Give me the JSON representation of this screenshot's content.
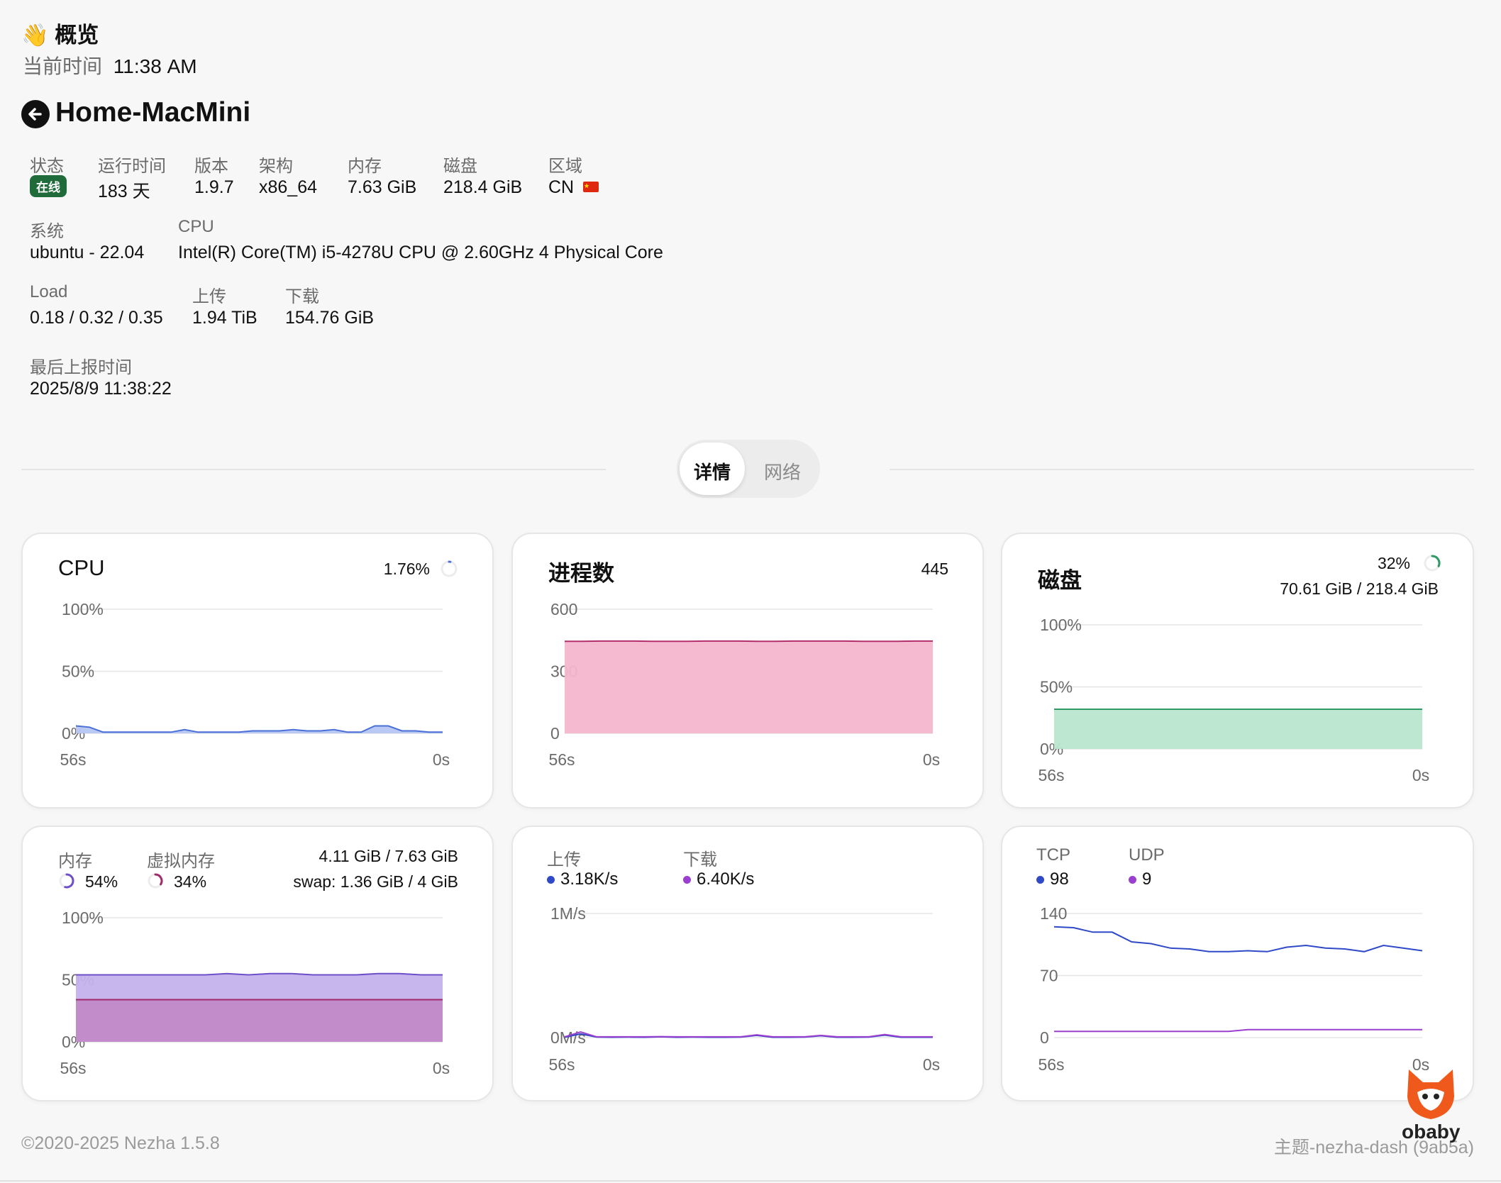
{
  "header": {
    "wave_icon": "waving-hand-icon",
    "title": "概览",
    "time_label": "当前时间",
    "time_value": "11:38 AM"
  },
  "server": {
    "name": "Home-MacMini",
    "back_icon": "arrow-left-circle-icon",
    "fields_row1": [
      {
        "label": "状态",
        "value": "在线"
      },
      {
        "label": "运行时间",
        "value": "183 天"
      },
      {
        "label": "版本",
        "value": "1.9.7"
      },
      {
        "label": "架构",
        "value": "x86_64"
      },
      {
        "label": "内存",
        "value": "7.63 GiB"
      },
      {
        "label": "磁盘",
        "value": "218.4 GiB"
      },
      {
        "label": "区域",
        "value": "CN"
      }
    ],
    "fields_row2": [
      {
        "label": "系统",
        "value": "ubuntu - 22.04"
      },
      {
        "label": "CPU",
        "value": "Intel(R) Core(TM) i5-4278U CPU @ 2.60GHz 4 Physical Core"
      }
    ],
    "fields_row3": [
      {
        "label": "Load",
        "value": "0.18 / 0.32 / 0.35"
      },
      {
        "label": "上传",
        "value": "1.94 TiB"
      },
      {
        "label": "下载",
        "value": "154.76 GiB"
      }
    ],
    "fields_row4": [
      {
        "label": "最后上报时间",
        "value": "2025/8/9 11:38:22"
      }
    ],
    "flag_icon": "china-flag-icon"
  },
  "tabs": [
    {
      "label": "详情",
      "active": true
    },
    {
      "label": "网络",
      "active": false
    }
  ],
  "cards": {
    "cpu": {
      "title": "CPU",
      "value": "1.76%",
      "ring_fraction": 0.0176
    },
    "process": {
      "title": "进程数",
      "value": "445"
    },
    "disk": {
      "title": "磁盘",
      "percent": "32%",
      "detail": "70.61 GiB / 218.4 GiB",
      "ring_fraction": 0.32
    },
    "memory": {
      "mem_label": "内存",
      "mem_percent": "54%",
      "mem_fraction": 0.54,
      "swap_label": "虚拟内存",
      "swap_percent": "34%",
      "swap_fraction": 0.34,
      "mem_detail": "4.11 GiB / 7.63 GiB",
      "swap_detail": "swap: 1.36 GiB / 4 GiB"
    },
    "network": {
      "up_label": "上传",
      "up_value": "3.18K/s",
      "down_label": "下载",
      "down_value": "6.40K/s"
    },
    "connections": {
      "tcp_label": "TCP",
      "tcp_value": "98",
      "udp_label": "UDP",
      "udp_value": "9"
    }
  },
  "chart_data": [
    {
      "type": "area",
      "name": "cpu",
      "x_labels": [
        "56s",
        "0s"
      ],
      "y_ticks": [
        "100%",
        "50%",
        "0%"
      ],
      "ylim": [
        0,
        100
      ],
      "color": "#4a6fd6",
      "fill": "#b5c6f2",
      "values": [
        6,
        5,
        1,
        1,
        1,
        1,
        1,
        1,
        3,
        1,
        1,
        1,
        1,
        2,
        2,
        2,
        3,
        2,
        2,
        3,
        1,
        1,
        6,
        6,
        2,
        2,
        1,
        1
      ]
    },
    {
      "type": "area",
      "name": "process",
      "x_labels": [
        "56s",
        "0s"
      ],
      "y_ticks": [
        "600",
        "300",
        "0"
      ],
      "ylim": [
        0,
        600
      ],
      "color": "#b3306e",
      "fill": "#f5b6cd",
      "values": [
        445,
        445,
        446,
        446,
        446,
        445,
        445,
        445,
        446,
        446,
        446,
        445,
        445,
        446,
        446,
        446,
        446,
        445,
        445,
        445,
        446,
        446
      ]
    },
    {
      "type": "area",
      "name": "disk",
      "x_labels": [
        "56s",
        "0s"
      ],
      "y_ticks": [
        "100%",
        "50%",
        "0%"
      ],
      "ylim": [
        0,
        100
      ],
      "color": "#2f9a63",
      "fill": "#b9e6cf",
      "values": [
        32,
        32,
        32,
        32,
        32,
        32,
        32,
        32,
        32,
        32
      ]
    },
    {
      "type": "area",
      "name": "memory",
      "x_labels": [
        "56s",
        "0s"
      ],
      "y_ticks": [
        "100%",
        "50%",
        "0%"
      ],
      "ylim": [
        0,
        100
      ],
      "series": [
        {
          "name": "内存",
          "color": "#6e4fc9",
          "fill": "#c3b2ec",
          "values": [
            54,
            54,
            54,
            54,
            54,
            54,
            54,
            55,
            54,
            55,
            55,
            54,
            54,
            54,
            55,
            55,
            54,
            54
          ]
        },
        {
          "name": "虚拟内存",
          "color": "#a02a6a",
          "fill": "#c289c7",
          "values": [
            34,
            34,
            34,
            34,
            34,
            34,
            34,
            34,
            34,
            34,
            34,
            34,
            34,
            34,
            34,
            34,
            34,
            34
          ]
        }
      ]
    },
    {
      "type": "line",
      "name": "network",
      "x_labels": [
        "56s",
        "0s"
      ],
      "y_ticks": [
        "1M/s",
        "0M/s"
      ],
      "ylim": [
        0,
        1000
      ],
      "series": [
        {
          "name": "上传",
          "color": "#2f49c7",
          "values": [
            3,
            30,
            4,
            3,
            4,
            3,
            6,
            3,
            4,
            3,
            3,
            4,
            18,
            3,
            3,
            4,
            15,
            3,
            3,
            4,
            20,
            3,
            3,
            3
          ]
        },
        {
          "name": "下载",
          "color": "#9a3fd0",
          "values": [
            6,
            45,
            6,
            6,
            6,
            6,
            8,
            6,
            6,
            6,
            6,
            6,
            22,
            6,
            6,
            6,
            18,
            6,
            6,
            6,
            25,
            6,
            6,
            6
          ]
        }
      ]
    },
    {
      "type": "line",
      "name": "connections",
      "x_labels": [
        "56s",
        "0s"
      ],
      "y_ticks": [
        "140",
        "70",
        "0"
      ],
      "ylim": [
        0,
        140
      ],
      "series": [
        {
          "name": "TCP",
          "color": "#2f49c7",
          "values": [
            125,
            124,
            119,
            119,
            108,
            106,
            101,
            100,
            97,
            97,
            98,
            97,
            102,
            104,
            101,
            100,
            97,
            104,
            101,
            98
          ]
        },
        {
          "name": "UDP",
          "color": "#9a3fd0",
          "values": [
            7,
            7,
            7,
            7,
            7,
            7,
            7,
            7,
            7,
            7,
            9,
            9,
            9,
            9,
            9,
            9,
            9,
            9,
            9,
            9
          ]
        }
      ]
    }
  ],
  "footer": {
    "copyright": "©2020-2025 Nezha 1.5.8",
    "theme": "主题-nezha-dash (9ab5a)",
    "watermark": "obaby"
  }
}
